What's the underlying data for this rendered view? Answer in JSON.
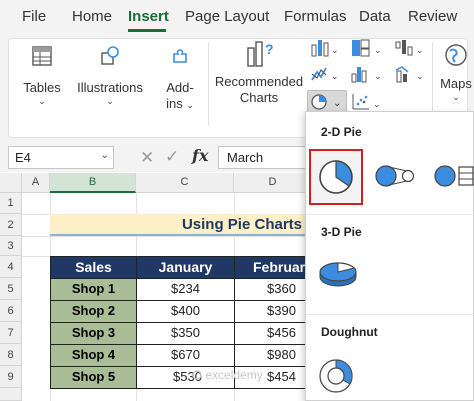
{
  "menu": {
    "tabs": [
      "File",
      "Home",
      "Insert",
      "Page Layout",
      "Formulas",
      "Data",
      "Review"
    ],
    "active": "Insert"
  },
  "ribbon": {
    "tables": "Tables",
    "illustrations": "Illustrations",
    "addins_line1": "Add-",
    "addins_line2": "ins",
    "recommended_line1": "Recommended",
    "recommended_line2": "Charts",
    "maps": "Maps"
  },
  "formula_bar": {
    "name_box": "E4",
    "fx": "fx",
    "value": "March"
  },
  "grid": {
    "columns": [
      "A",
      "B",
      "C",
      "D"
    ],
    "selected_column": "B",
    "rows": [
      "1",
      "2",
      "3",
      "4",
      "5",
      "6",
      "7",
      "8",
      "9"
    ]
  },
  "sheet": {
    "title": "Using Pie Charts",
    "headers": [
      "Sales",
      "January",
      "Februar"
    ],
    "rows": [
      {
        "shop": "Shop 1",
        "jan": "$234",
        "feb": "$360"
      },
      {
        "shop": "Shop 2",
        "jan": "$400",
        "feb": "$390"
      },
      {
        "shop": "Shop 3",
        "jan": "$350",
        "feb": "$456"
      },
      {
        "shop": "Shop 4",
        "jan": "$670",
        "feb": "$980"
      },
      {
        "shop": "Shop 5",
        "jan": "$530",
        "feb": "$454"
      }
    ]
  },
  "dropdown": {
    "section_2d": "2-D Pie",
    "section_3d": "3-D Pie",
    "section_doughnut": "Doughnut"
  },
  "watermark": "exceldemy",
  "colors": {
    "accent_green": "#1e6b3a",
    "header_navy": "#203864",
    "shop_green": "#a9bd96",
    "title_fill": "#fdf0c6",
    "selection_red": "#d32020",
    "icon_blue": "#3c8ddf"
  }
}
